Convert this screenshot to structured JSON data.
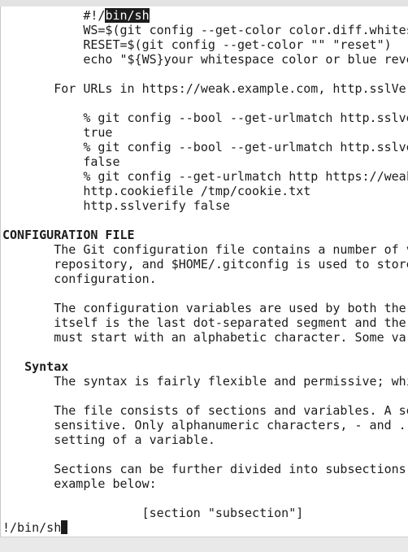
{
  "lines": [
    {
      "indent": "           ",
      "pre": "#!/",
      "sel": "bin/sh",
      "post": ""
    },
    {
      "indent": "           ",
      "text": "WS=$(git config --get-color color.diff.whitespace \"blue reverse\")"
    },
    {
      "indent": "           ",
      "text": "RESET=$(git config --get-color \"\" \"reset\")"
    },
    {
      "indent": "           ",
      "text": "echo \"${WS}your whitespace color or blue reverse${RESET}\""
    },
    {
      "indent": "",
      "text": ""
    },
    {
      "indent": "       ",
      "text": "For URLs in https://weak.example.com, http.sslVerify is set to false, while it is set"
    },
    {
      "indent": "",
      "text": ""
    },
    {
      "indent": "           ",
      "text": "% git config --bool --get-urlmatch http.sslverify https://good.example.com"
    },
    {
      "indent": "           ",
      "text": "true"
    },
    {
      "indent": "           ",
      "text": "% git config --bool --get-urlmatch http.sslverify https://weak.example.com"
    },
    {
      "indent": "           ",
      "text": "false"
    },
    {
      "indent": "           ",
      "text": "% git config --get-urlmatch http https://weak.example.com"
    },
    {
      "indent": "           ",
      "text": "http.cookiefile /tmp/cookie.txt"
    },
    {
      "indent": "           ",
      "text": "http.sslverify false"
    },
    {
      "indent": "",
      "text": ""
    },
    {
      "indent": "",
      "text": "CONFIGURATION FILE",
      "bold": true
    },
    {
      "indent": "       ",
      "text": "The Git configuration file contains a number of variables that affect the Git command"
    },
    {
      "indent": "       ",
      "text": "repository, and $HOME/.gitconfig is used to store a per-user configuration as fallback"
    },
    {
      "indent": "       ",
      "text": "configuration."
    },
    {
      "indent": "",
      "text": ""
    },
    {
      "indent": "       ",
      "text": "The configuration variables are used by both the Git plumbing and the porcelains. The v"
    },
    {
      "indent": "       ",
      "text": "itself is the last dot-separated segment and the section name is everything before the"
    },
    {
      "indent": "       ",
      "text": "must start with an alphabetic character. Some variables may appear multiple times; we s"
    },
    {
      "indent": "",
      "text": ""
    },
    {
      "indent": "   ",
      "text": "Syntax",
      "bold": true
    },
    {
      "indent": "       ",
      "text": "The syntax is fairly flexible and permissive; whitespaces are mostly ignored. The # and"
    },
    {
      "indent": "",
      "text": ""
    },
    {
      "indent": "       ",
      "text": "The file consists of sections and variables. A section begins with the name of the sec"
    },
    {
      "indent": "       ",
      "text": "sensitive. Only alphanumeric characters, - and . are allowed in section names. Each var"
    },
    {
      "indent": "       ",
      "text": "setting of a variable."
    },
    {
      "indent": "",
      "text": ""
    },
    {
      "indent": "       ",
      "text": "Sections can be further divided into subsections. To begin a subsection put its name i"
    },
    {
      "indent": "       ",
      "text": "example below:"
    },
    {
      "indent": "",
      "text": ""
    },
    {
      "indent": "                   ",
      "text": "[section \"subsection\"]"
    }
  ],
  "prompt": {
    "text": "!/bin/sh"
  }
}
